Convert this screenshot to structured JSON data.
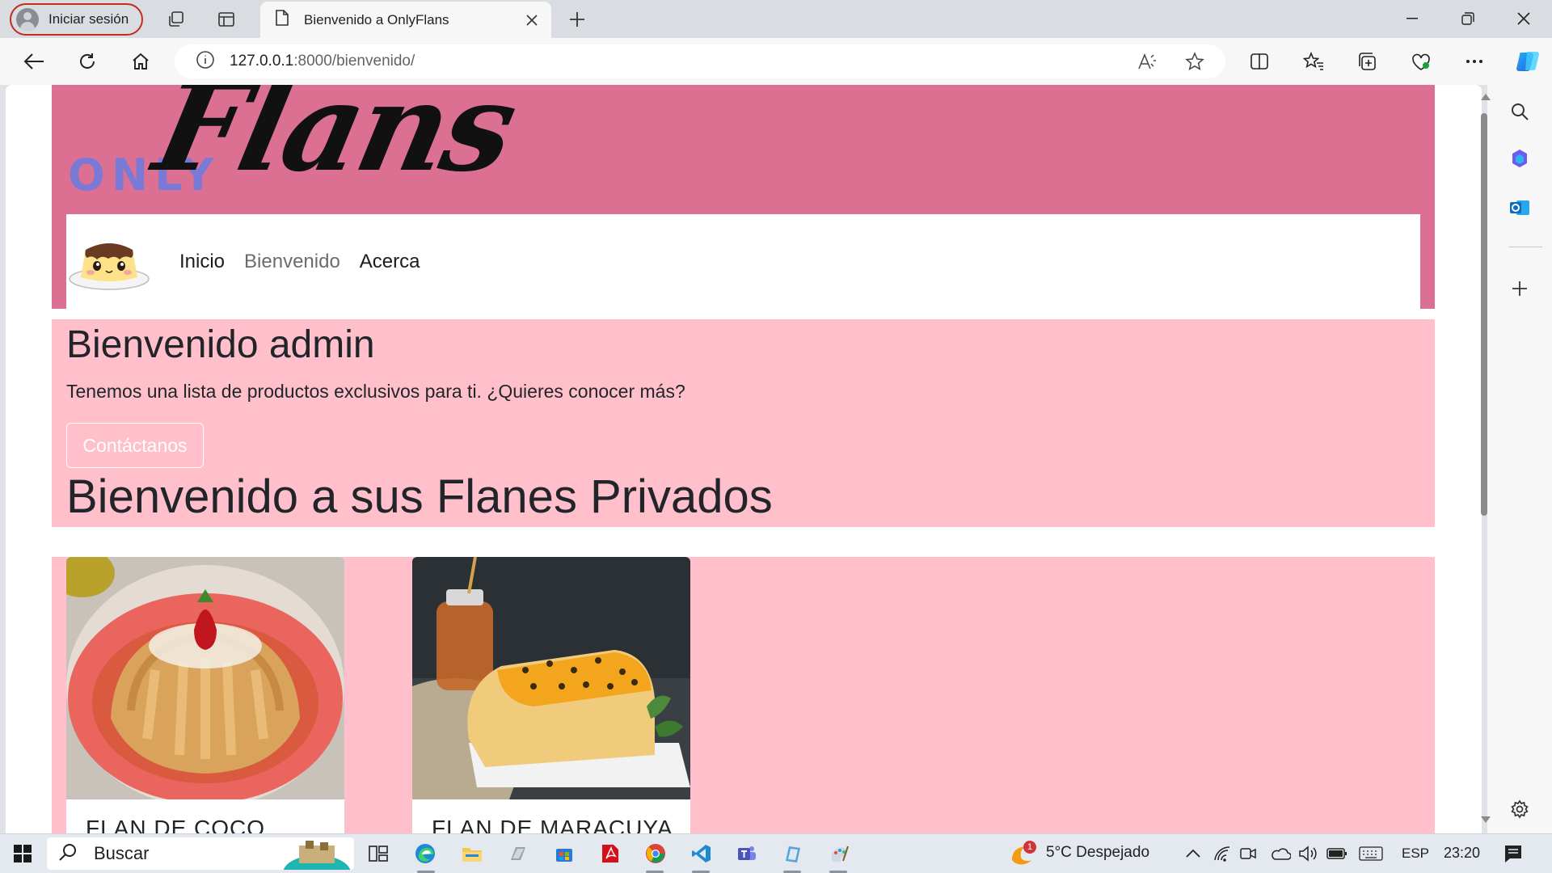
{
  "browser": {
    "profile_label": "Iniciar sesión",
    "tab_title": "Bienvenido a OnlyFlans",
    "url_host": "127.0.0.1",
    "url_path": ":8000/bienvenido/"
  },
  "site": {
    "logo_only": "ONLY",
    "logo_flans": "Flans",
    "nav": {
      "inicio": "Inicio",
      "bienvenido": "Bienvenido",
      "acerca": "Acerca"
    },
    "hero": {
      "title": "Bienvenido admin",
      "text": "Tenemos una lista de productos exclusivos para ti. ¿Quieres conocer más?",
      "button": "Contáctanos",
      "subtitle": "Bienvenido a sus Flanes Privados"
    },
    "products": [
      {
        "title": "FLAN DE COCO"
      },
      {
        "title": "FLAN DE MARACUYA"
      }
    ]
  },
  "taskbar": {
    "search_label": "Buscar",
    "weather": "5°C  Despejado",
    "weather_badge": "1",
    "language": "ESP",
    "clock": "23:20"
  },
  "colors": {
    "header_pink": "#dc7093",
    "section_pink": "#ffc0cb",
    "logo_purple": "#7a7ad6"
  }
}
